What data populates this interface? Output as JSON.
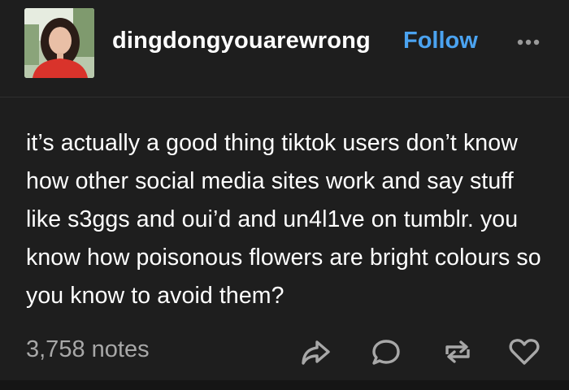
{
  "post": {
    "username": "dingdongyouarewrong",
    "follow_label": "Follow",
    "body": "it’s actually a good thing tiktok users don’t know how other social media sites work and say stuff like s3ggs and oui’d and un4l1ve on tumblr. you know how poisonous flowers are bright colours so you know to avoid them?",
    "notes": "3,758 notes"
  },
  "icons": {
    "more": "more-dots-icon",
    "share": "share-icon",
    "reply": "reply-icon",
    "reblog": "reblog-icon",
    "like": "heart-icon"
  },
  "colors": {
    "background": "#1e1e1e",
    "text": "#ffffff",
    "accent": "#4ba3f0",
    "muted": "#a8a8a8"
  }
}
